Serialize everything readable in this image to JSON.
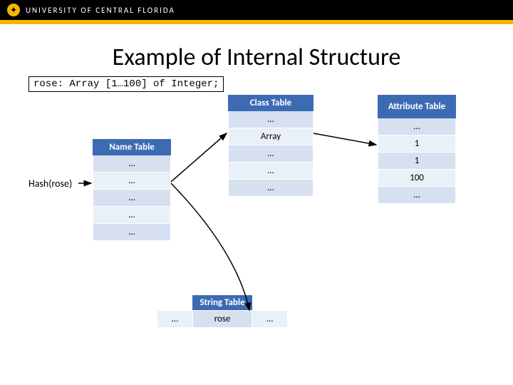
{
  "header": {
    "university": "UNIVERSITY OF CENTRAL FLORIDA",
    "logo_glyph": "✦"
  },
  "slide": {
    "title": "Example of Internal Structure",
    "code": "rose: Array [1…100] of Integer;",
    "hash_label": "Hash(rose)",
    "name_table": {
      "header": "Name Table",
      "rows": [
        "…",
        "…",
        "…",
        "…",
        "…"
      ]
    },
    "class_table": {
      "header": "Class Table",
      "rows": [
        "…",
        "Array",
        "…",
        "…",
        "…"
      ]
    },
    "attr_table": {
      "header": "Attribute Table",
      "rows": [
        "…",
        "1",
        "1",
        "100",
        "…"
      ]
    },
    "string_table": {
      "header": "String Table",
      "cells": [
        "…",
        "rose",
        "…"
      ]
    }
  }
}
